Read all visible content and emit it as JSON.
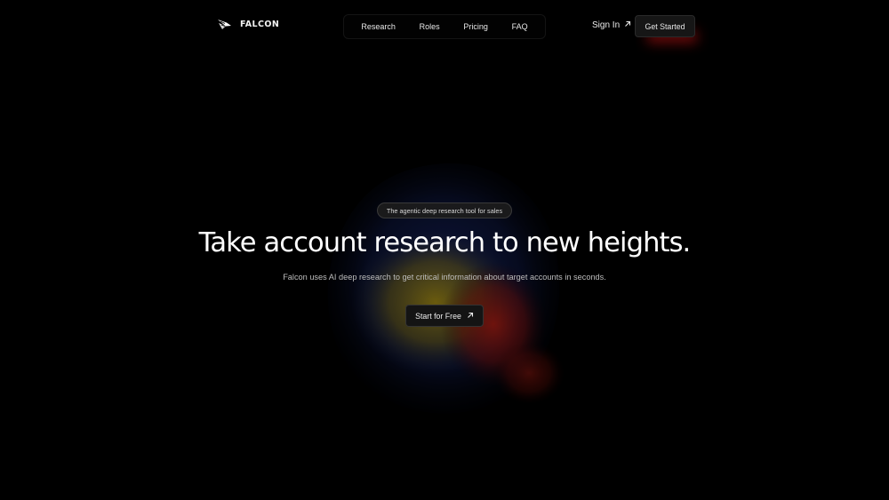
{
  "brand": {
    "name": "FALCON",
    "logo_icon": "falcon-wing-icon"
  },
  "nav": {
    "items": [
      {
        "label": "Research"
      },
      {
        "label": "Roles"
      },
      {
        "label": "Pricing"
      },
      {
        "label": "FAQ"
      }
    ]
  },
  "header_actions": {
    "sign_in_label": "Sign In",
    "sign_in_icon": "arrow-up-right-icon",
    "get_started_label": "Get Started"
  },
  "hero": {
    "tagline": "The agentic deep research tool for sales",
    "headline": "Take account research to new heights.",
    "subtitle": "Falcon uses AI deep research to get critical information about target accounts in seconds.",
    "cta_label": "Start for Free",
    "cta_icon": "arrow-up-right-icon"
  },
  "colors": {
    "background": "#000000",
    "orb_blue": "#2d4fd6",
    "orb_yellow": "#f0c21e",
    "orb_red": "#e21a1a",
    "accent_glow": "#d21414"
  }
}
